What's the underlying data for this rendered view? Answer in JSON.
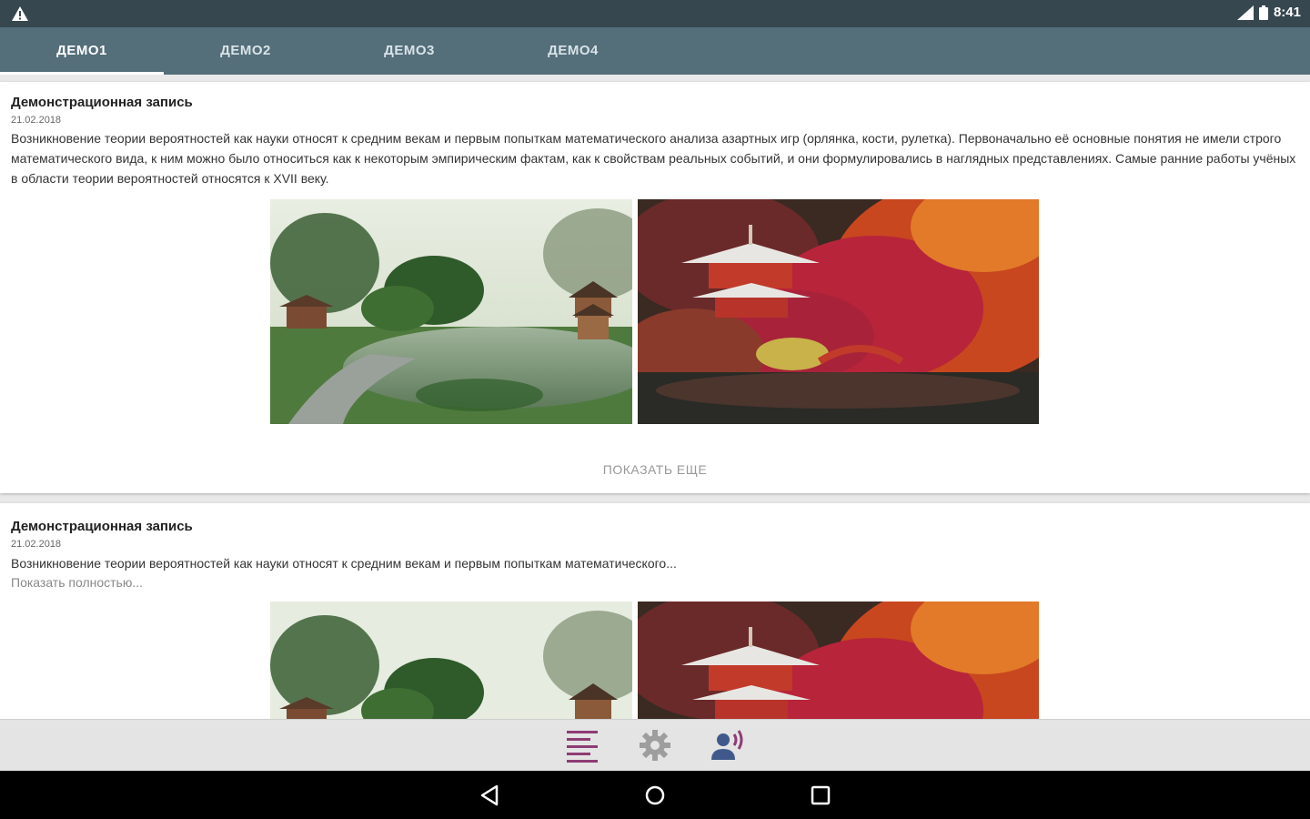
{
  "status_bar": {
    "time": "8:41",
    "icons": [
      "warning-icon",
      "signal-icon",
      "battery-icon"
    ]
  },
  "tabs": [
    {
      "label": "ДЕМО1",
      "active": true
    },
    {
      "label": "ДЕМО2",
      "active": false
    },
    {
      "label": "ДЕМО3",
      "active": false
    },
    {
      "label": "ДЕМО4",
      "active": false
    }
  ],
  "posts": [
    {
      "title": "Демонстрационная запись",
      "date": "21.02.2018",
      "body": "Возникновение теории вероятностей как науки относят к средним векам и первым попыткам математического анализа азартных игр (орлянка, кости, рулетка). Первоначально её основные понятия не имели строго математического вида, к ним можно было относиться как к некоторым эмпирическим фактам, как к свойствам реальных событий, и они формулировались в наглядных представлениях. Самые ранние работы учёных в области теории вероятностей относятся к XVII веку.",
      "show_more": "ПОКАЗАТЬ ЕЩЕ"
    },
    {
      "title": "Демонстрационная запись",
      "date": "21.02.2018",
      "body": "Возникновение теории вероятностей как науки относят к средним векам и первым попыткам математического...",
      "expand": "Показать полностью..."
    }
  ],
  "images": [
    "chinese-garden-pond",
    "japanese-pagoda-autumn"
  ],
  "bottom_nav": [
    "feed-icon",
    "settings-icon",
    "contact-voice-icon"
  ],
  "colors": {
    "status_bar": "#37474f",
    "tab_bar": "#546e7a",
    "accent": "#8e3c74",
    "icon_gray": "#9e9e9e",
    "icon_blue": "#3f5a8a"
  }
}
